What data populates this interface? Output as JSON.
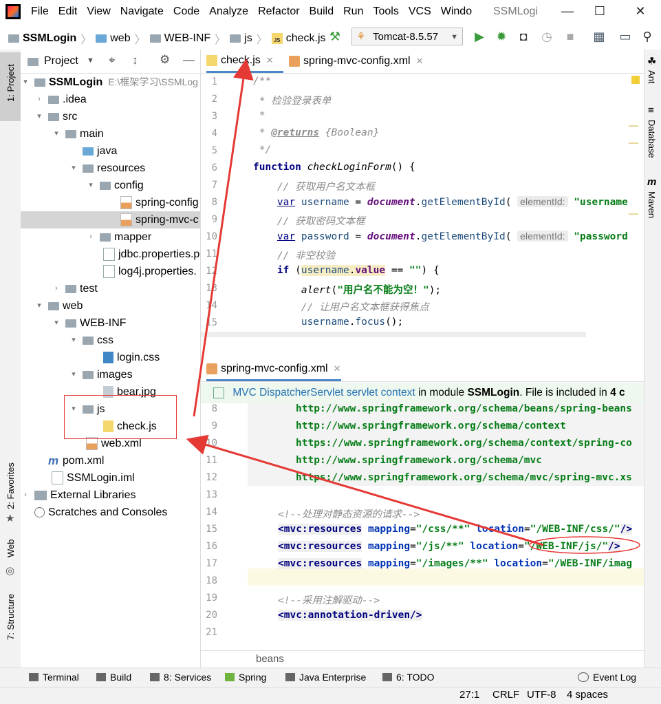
{
  "window": {
    "title": "SSMLogi",
    "menu": [
      "File",
      "Edit",
      "View",
      "Navigate",
      "Code",
      "Analyze",
      "Refactor",
      "Build",
      "Run",
      "Tools",
      "VCS",
      "Windo"
    ]
  },
  "breadcrumb": [
    "SSMLogin",
    "web",
    "WEB-INF",
    "js",
    "check.js"
  ],
  "run_config": "Tomcat-8.5.57",
  "left_stripe": {
    "project": "1: Project",
    "favorites": "2: Favorites",
    "web": "Web",
    "structure": "7: Structure"
  },
  "right_stripe": [
    "Ant",
    "Database",
    "Maven"
  ],
  "project_panel": {
    "title": "Project",
    "tree": [
      {
        "label": "SSMLogin",
        "extra": "E:\\框架学习\\SSMLog"
      },
      {
        "label": ".idea"
      },
      {
        "label": "src"
      },
      {
        "label": "main"
      },
      {
        "label": "java"
      },
      {
        "label": "resources"
      },
      {
        "label": "config"
      },
      {
        "label": "spring-config"
      },
      {
        "label": "spring-mvc-c"
      },
      {
        "label": "mapper"
      },
      {
        "label": "jdbc.properties.p"
      },
      {
        "label": "log4j.properties."
      },
      {
        "label": "test"
      },
      {
        "label": "web"
      },
      {
        "label": "WEB-INF"
      },
      {
        "label": "css"
      },
      {
        "label": "login.css"
      },
      {
        "label": "images"
      },
      {
        "label": "bear.jpg"
      },
      {
        "label": "js"
      },
      {
        "label": "check.js"
      },
      {
        "label": "web.xml"
      },
      {
        "label": "pom.xml"
      },
      {
        "label": "SSMLogin.iml"
      },
      {
        "label": "External Libraries"
      },
      {
        "label": "Scratches and Consoles"
      }
    ]
  },
  "editor_top": {
    "tabs": [
      "check.js",
      "spring-mvc-config.xml"
    ],
    "line_numbers": [
      "1",
      "2",
      "3",
      "4",
      "5",
      "6",
      "7",
      "8",
      "9",
      "10",
      "11",
      "12",
      "13",
      "14",
      "15"
    ]
  },
  "editor_bottom": {
    "tab": "spring-mvc-config.xml",
    "banner": {
      "link": "MVC DispatcherServlet servlet context",
      "text1": " in module ",
      "module": "SSMLogin",
      "text2": ". File is included in ",
      "count": "4 c"
    },
    "line_numbers": [
      "8",
      "9",
      "10",
      "11",
      "12",
      "13",
      "14",
      "15",
      "16",
      "17",
      "18",
      "19",
      "20",
      "21"
    ],
    "footer_crumb": "beans"
  },
  "bottom_tools": [
    "Terminal",
    "Build",
    "8: Services",
    "Spring",
    "Java Enterprise",
    "6: TODO",
    "Event Log"
  ],
  "status": {
    "position": "27:1",
    "line_sep": "CRLF",
    "encoding": "UTF-8",
    "indent": "4 spaces"
  }
}
